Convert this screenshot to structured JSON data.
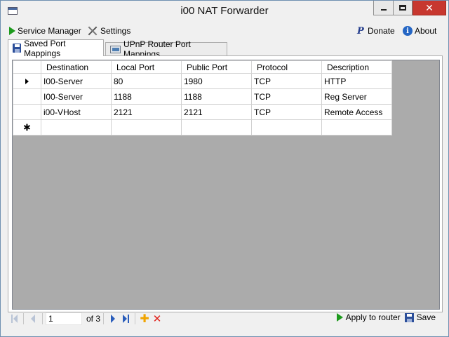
{
  "window": {
    "title": "i00 NAT Forwarder",
    "close_glyph": "✕"
  },
  "menu": {
    "service_manager": {
      "label": "Service Manager",
      "icon": "play-icon"
    },
    "settings": {
      "label": "Settings",
      "icon": "tools-icon"
    },
    "donate": {
      "label": "Donate",
      "icon": "paypal-icon",
      "glyph": "P"
    },
    "about": {
      "label": "About",
      "icon": "info-icon",
      "glyph": "i"
    }
  },
  "tabs": [
    {
      "label": "Saved Port Mappings",
      "active": true
    },
    {
      "label": "UPnP Router Port Mappings",
      "active": false
    }
  ],
  "grid": {
    "columns": [
      "Destination",
      "Local Port",
      "Public Port",
      "Protocol",
      "Description"
    ],
    "rows": [
      [
        "I00-Server",
        "80",
        "1980",
        "TCP",
        "HTTP"
      ],
      [
        "I00-Server",
        "1188",
        "1188",
        "TCP",
        "Reg Server"
      ],
      [
        "i00-VHost",
        "2121",
        "2121",
        "TCP",
        "Remote Access"
      ]
    ],
    "new_row_glyph": "✱"
  },
  "navigator": {
    "current_page": "1",
    "of_label": "of 3",
    "add_glyph": "✚",
    "delete_glyph": "✕",
    "apply_label": "Apply to router",
    "save_label": "Save"
  },
  "colors": {
    "accent_green": "#1d9a1d",
    "nav_blue": "#2a5dbb",
    "close_red": "#c7372f",
    "grid_bg": "#ababab"
  }
}
